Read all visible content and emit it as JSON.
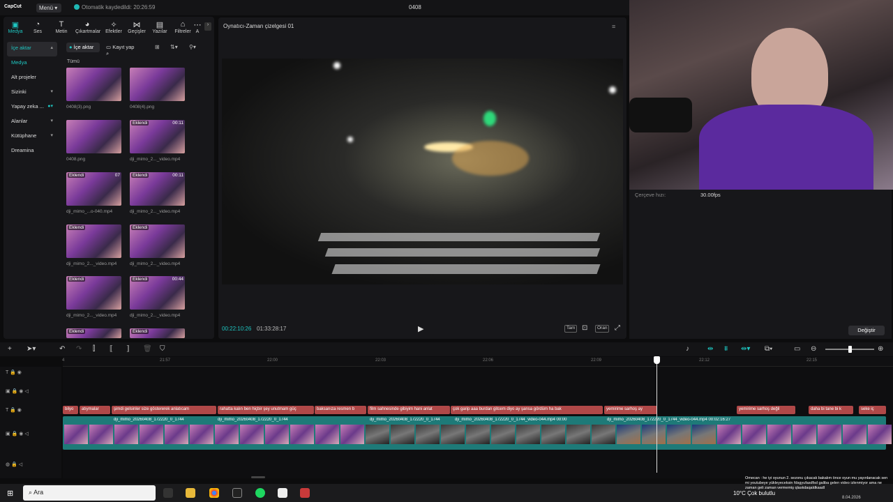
{
  "app": {
    "logo": "CapCut",
    "menu_label": "Menü",
    "autosave": "Otomatik kaydedildi: 20:26:59",
    "project_title": "0408"
  },
  "toolbar": {
    "tools": [
      {
        "label": "Medya",
        "icon": "media-icon"
      },
      {
        "label": "Ses",
        "icon": "audio-icon"
      },
      {
        "label": "Metin",
        "icon": "text-icon"
      },
      {
        "label": "Çıkartmalar",
        "icon": "sticker-icon"
      },
      {
        "label": "Efektler",
        "icon": "effects-icon"
      },
      {
        "label": "Geçişler",
        "icon": "transition-icon"
      },
      {
        "label": "Yazılar",
        "icon": "captions-icon"
      },
      {
        "label": "Filtreler",
        "icon": "filter-icon"
      },
      {
        "label": "A",
        "icon": "adjust-icon"
      }
    ]
  },
  "sidebar": {
    "items": [
      {
        "label": "İçe aktar"
      },
      {
        "label": "Medya"
      },
      {
        "label": "Alt projeler"
      },
      {
        "label": "Sizinki"
      },
      {
        "label": "Yapay zeka ..."
      },
      {
        "label": "Alanlar"
      },
      {
        "label": "Kütüphane"
      },
      {
        "label": "Dreamina"
      }
    ]
  },
  "media": {
    "import_label": "İçe aktar",
    "record_label": "Kayıt yap",
    "all_label": "Tümü",
    "added_badge": "Eklendi",
    "items": [
      {
        "name": "0408(3).png",
        "badge": "",
        "dur": ""
      },
      {
        "name": "0408(4).png",
        "badge": "",
        "dur": ""
      },
      {
        "name": "0408.png",
        "badge": "",
        "dur": ""
      },
      {
        "name": "dji_mimo_2..._video.mp4",
        "badge": "Eklendi",
        "dur": "00:11"
      },
      {
        "name": "dji_mimo_...o-040.mp4",
        "badge": "Eklendi",
        "dur": "07"
      },
      {
        "name": "dji_mimo_2..._video.mp4",
        "badge": "Eklendi",
        "dur": "00:11"
      },
      {
        "name": "dji_mimo_2..._video.mp4",
        "badge": "Eklendi",
        "dur": ""
      },
      {
        "name": "dji_mimo_2..._video.mp4",
        "badge": "Eklendi",
        "dur": ""
      },
      {
        "name": "dji_mimo_2..._video.mp4",
        "badge": "Eklendi",
        "dur": ""
      },
      {
        "name": "dji_mimo_2..._video.mp4",
        "badge": "Eklendi",
        "dur": "00:44"
      },
      {
        "name": "",
        "badge": "Eklendi",
        "dur": ""
      },
      {
        "name": "",
        "badge": "Eklendi",
        "dur": ""
      }
    ]
  },
  "player": {
    "title": "Oynatıcı-Zaman çizelgesi 01",
    "time_current": "00:22:10:26",
    "time_total": "01:33:28:17",
    "btn_full": "Tam",
    "btn_ratio": "Oran"
  },
  "properties": {
    "fps_label": "Çerçeve hızı:",
    "fps_value": "30.00fps",
    "change_label": "Değiştir"
  },
  "timeline": {
    "ticks": [
      "4",
      "21:57",
      "22:00",
      "22:03",
      "22:06",
      "22:09",
      "22:12",
      "22:15"
    ],
    "text_clips": [
      "bilyo",
      "atıymalar",
      "şimdi gelsinler size göstererek anlatıcam",
      "rahatta kalın ben hiçbir şey unutmam güç",
      "baksanıza resmen b",
      "film sahnesinde gibiyim hani anlat",
      "çok garip aaa burdan gitcem diyo ay şansa gördüm ha bak",
      "yemirime sarhoş ay",
      "yemirime sarhoş değil",
      "daha bi tane bi k",
      "seke iç"
    ],
    "video_clips": [
      "dji_mimo_20260408_172220_0_1744 ",
      "dji_mimo_20260408_172220_0_1744",
      "dji_mimo_20260408_172220_0_1744",
      "dji_mimo_20260408_172220_0_1744_video-044.mp4  00:00",
      "dji_mimo_20260408_172220_0_1744_video-044.mp4  00:02:16:27"
    ]
  },
  "taskbar": {
    "search_placeholder": "Ara",
    "weather": "10°C Çok bulutlu",
    "date": "8.04.2026",
    "chat": "Omecan : he iyi oyunun 2. sezonu çıkacak bakalım önce oyun mu yayınlanacak sen mi youtubeye yükleyeceksin fdsgyufasdfsd galiba gelen video izlenmiyor ama ne zaman geli zaman vermemiş qlaskdaqaldkaadl"
  }
}
